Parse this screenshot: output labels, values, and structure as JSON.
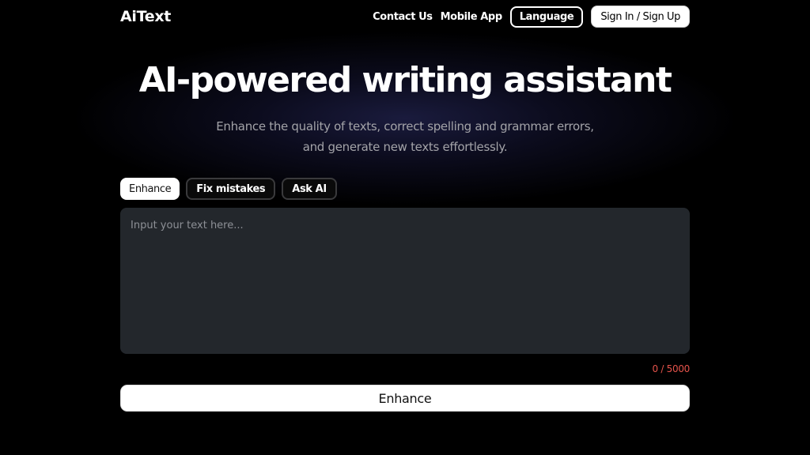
{
  "header": {
    "logo": "AiText",
    "nav": {
      "contact": "Contact Us",
      "mobile_app": "Mobile App",
      "language": "Language",
      "sign_in": "Sign In / Sign Up"
    }
  },
  "hero": {
    "title": "AI-powered writing assistant",
    "subtitle_line1": "Enhance the quality of texts, correct spelling and grammar errors,",
    "subtitle_line2": "and generate new texts effortlessly."
  },
  "tabs": [
    {
      "label": "Enhance",
      "active": true
    },
    {
      "label": "Fix mistakes",
      "active": false
    },
    {
      "label": "Ask AI",
      "active": false
    }
  ],
  "editor": {
    "value": "",
    "placeholder": "Input your text here...",
    "counter": "0 / 5000"
  },
  "submit": {
    "label": "Enhance"
  },
  "colors": {
    "background": "#000000",
    "editor_bg": "#23272c",
    "counter": "#e5534b",
    "button_bg": "#ffffff"
  }
}
